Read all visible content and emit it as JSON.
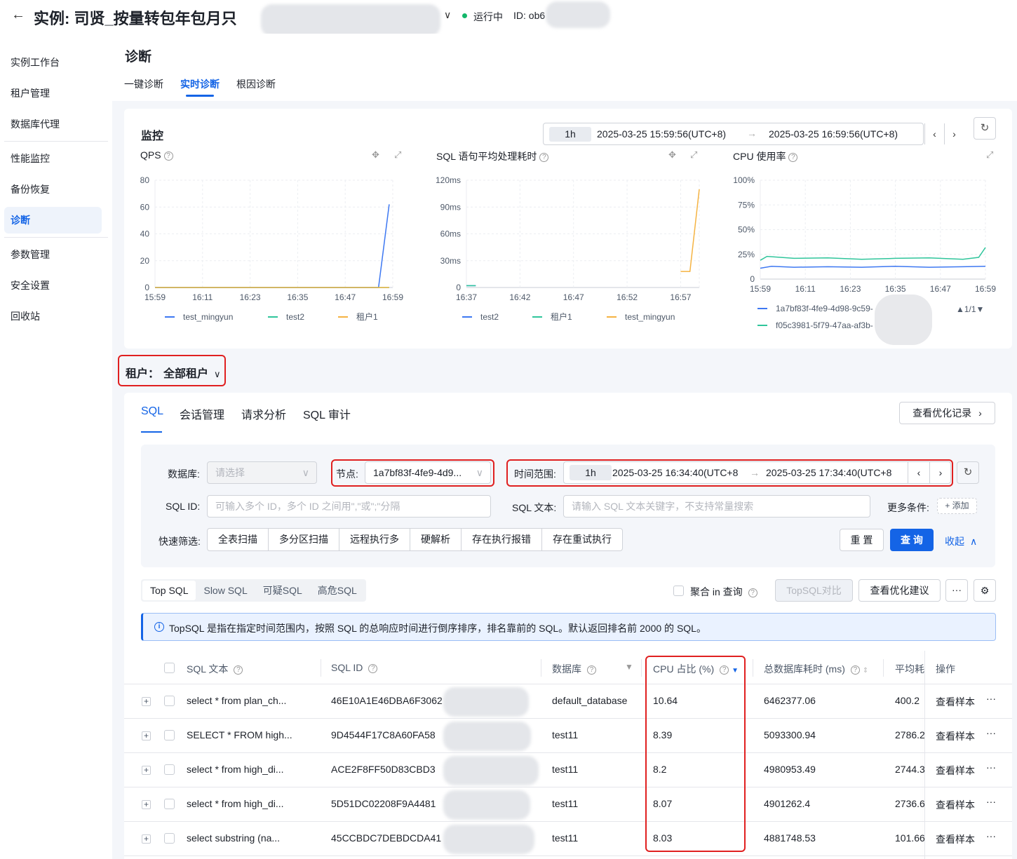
{
  "header": {
    "title": "实例: 司贤_按量转包年包月只",
    "status": "运行中",
    "instance_id": "ID: ob6"
  },
  "sidebar": {
    "items": [
      "实例工作台",
      "租户管理",
      "数据库代理",
      "性能监控",
      "备份恢复",
      "诊断",
      "参数管理",
      "安全设置",
      "回收站"
    ],
    "active": "诊断"
  },
  "page": {
    "title": "诊断",
    "tabs": [
      "一键诊断",
      "实时诊断",
      "根因诊断"
    ],
    "active_tab": "实时诊断"
  },
  "monitor": {
    "title": "监控",
    "range_preset": "1h",
    "range_start": "2025-03-25 15:59:56(UTC+8)",
    "range_end": "2025-03-25 16:59:56(UTC+8)"
  },
  "chart_data": [
    {
      "type": "line",
      "title": "QPS",
      "x_ticks": [
        "15:59",
        "16:11",
        "16:23",
        "16:35",
        "16:47",
        "16:59"
      ],
      "y_ticks": [
        "80",
        "60",
        "40",
        "20",
        "0"
      ],
      "ylim": [
        0,
        80
      ],
      "series": [
        {
          "name": "test_mingyun",
          "color": "#3d78f2",
          "points": [
            [
              0,
              0
            ],
            [
              0.94,
              0
            ],
            [
              0.985,
              62
            ]
          ]
        },
        {
          "name": "test2",
          "color": "#2fc59b",
          "points": [
            [
              0,
              0
            ],
            [
              0.985,
              0
            ]
          ]
        },
        {
          "name": "租户1",
          "color": "#f5b342",
          "points": [
            [
              0,
              0
            ],
            [
              0.985,
              0
            ]
          ]
        }
      ]
    },
    {
      "type": "line",
      "title": "SQL 语句平均处理耗时",
      "x_ticks": [
        "16:37",
        "16:42",
        "16:47",
        "16:52",
        "16:57"
      ],
      "y_ticks": [
        "120ms",
        "90ms",
        "60ms",
        "30ms",
        "0"
      ],
      "ylim": [
        0,
        120
      ],
      "series": [
        {
          "name": "test2",
          "color": "#3d78f2",
          "points": [
            [
              0.0,
              2
            ],
            [
              0.04,
              2
            ]
          ]
        },
        {
          "name": "租户1",
          "color": "#2fc59b",
          "points": [
            [
              0.0,
              2
            ],
            [
              0.04,
              2
            ]
          ]
        },
        {
          "name": "test_mingyun",
          "color": "#f5b342",
          "points": [
            [
              0.92,
              18
            ],
            [
              0.96,
              18
            ],
            [
              1.0,
              110
            ]
          ]
        }
      ]
    },
    {
      "type": "line",
      "title": "CPU 使用率",
      "x_ticks": [
        "15:59",
        "16:11",
        "16:23",
        "16:35",
        "16:47",
        "16:59"
      ],
      "y_ticks": [
        "100%",
        "75%",
        "50%",
        "25%",
        "0"
      ],
      "ylim": [
        0,
        100
      ],
      "series": [
        {
          "name": "1a7bf83f-4fe9-4d98-9c59-",
          "color": "#3d78f2",
          "points": [
            [
              0,
              11
            ],
            [
              0.05,
              13
            ],
            [
              0.15,
              12
            ],
            [
              0.3,
              12.5
            ],
            [
              0.45,
              12
            ],
            [
              0.6,
              13
            ],
            [
              0.75,
              12
            ],
            [
              0.9,
              12.5
            ],
            [
              1.0,
              13
            ]
          ]
        },
        {
          "name": "f05c3981-5f79-47aa-af3b-",
          "color": "#2fc59b",
          "points": [
            [
              0,
              19
            ],
            [
              0.03,
              23
            ],
            [
              0.15,
              21
            ],
            [
              0.3,
              21.5
            ],
            [
              0.45,
              20
            ],
            [
              0.6,
              21
            ],
            [
              0.75,
              21.5
            ],
            [
              0.9,
              20
            ],
            [
              0.97,
              22
            ],
            [
              1.0,
              32
            ]
          ]
        }
      ],
      "legend_pager": "▲1/1▼"
    }
  ],
  "tenant": {
    "label": "租户：",
    "value": "全部租户"
  },
  "sql_tabs": [
    "SQL",
    "会话管理",
    "请求分析",
    "SQL 审计"
  ],
  "sql_active_tab": "SQL",
  "view_records_btn": "查看优化记录",
  "filters": {
    "db_label": "数据库:",
    "db_placeholder": "请选择",
    "node_label": "节点:",
    "node_value": "1a7bf83f-4fe9-4d9...",
    "time_label": "时间范围:",
    "time_preset": "1h",
    "time_start": "2025-03-25 16:34:40(UTC+8",
    "time_end": "2025-03-25 17:34:40(UTC+8",
    "sqlid_label": "SQL ID:",
    "sqlid_placeholder": "可输入多个 ID，多个 ID 之间用\",\"或\";\"分隔",
    "sqltext_label": "SQL 文本:",
    "sqltext_placeholder": "请输入 SQL 文本关键字，不支持常量搜索",
    "more_label": "更多条件:",
    "add_label": "+ 添加",
    "quick_label": "快速筛选:",
    "quick": [
      "全表扫描",
      "多分区扫描",
      "远程执行多",
      "硬解析",
      "存在执行报错",
      "存在重试执行"
    ],
    "reset": "重 置",
    "query": "查 询",
    "collapse": "收起"
  },
  "seg": [
    "Top SQL",
    "Slow SQL",
    "可疑SQL",
    "高危SQL"
  ],
  "seg_active": "Top SQL",
  "aggregate_label": "聚合 in 查询",
  "topsql_compare": "TopSQL对比",
  "view_advice": "查看优化建议",
  "more_btn": "···",
  "info_text": "TopSQL 是指在指定时间范围内，按照 SQL 的总响应时间进行倒序排序，排名靠前的 SQL。默认返回排名前 2000 的 SQL。",
  "table": {
    "headers": {
      "sql_text": "SQL 文本",
      "sql_id": "SQL ID",
      "database": "数据库",
      "cpu": "CPU 占比 (%)",
      "total_time": "总数据库耗时 (ms)",
      "avg": "平均耗",
      "ops": "操作"
    },
    "rows": [
      {
        "sql_text": "select * from plan_ch...",
        "sql_id": "46E10A1E46DBA6F3062",
        "database": "default_database",
        "cpu": "10.64",
        "total": "6462377.06",
        "avg": "400.2",
        "op": "查看样本"
      },
      {
        "sql_text": "SELECT * FROM high...",
        "sql_id": "9D4544F17C8A60FA58",
        "database": "test11",
        "cpu": "8.39",
        "total": "5093300.94",
        "avg": "2786.2",
        "op": "查看样本"
      },
      {
        "sql_text": "select * from high_di...",
        "sql_id": "ACE2F8FF50D83CBD3",
        "database": "test11",
        "cpu": "8.2",
        "total": "4980953.49",
        "avg": "2744.3",
        "op": "查看样本"
      },
      {
        "sql_text": "select * from high_di...",
        "sql_id": "5D51DC02208F9A4481",
        "database": "test11",
        "cpu": "8.07",
        "total": "4901262.4",
        "avg": "2736.6",
        "op": "查看样本"
      },
      {
        "sql_text": "select substring (na...",
        "sql_id": "45CCBDC7DEBDCDA41",
        "database": "test11",
        "cpu": "8.03",
        "total": "4881748.53",
        "avg": "101.66",
        "op": "查看样本"
      }
    ],
    "row_more": "···"
  }
}
